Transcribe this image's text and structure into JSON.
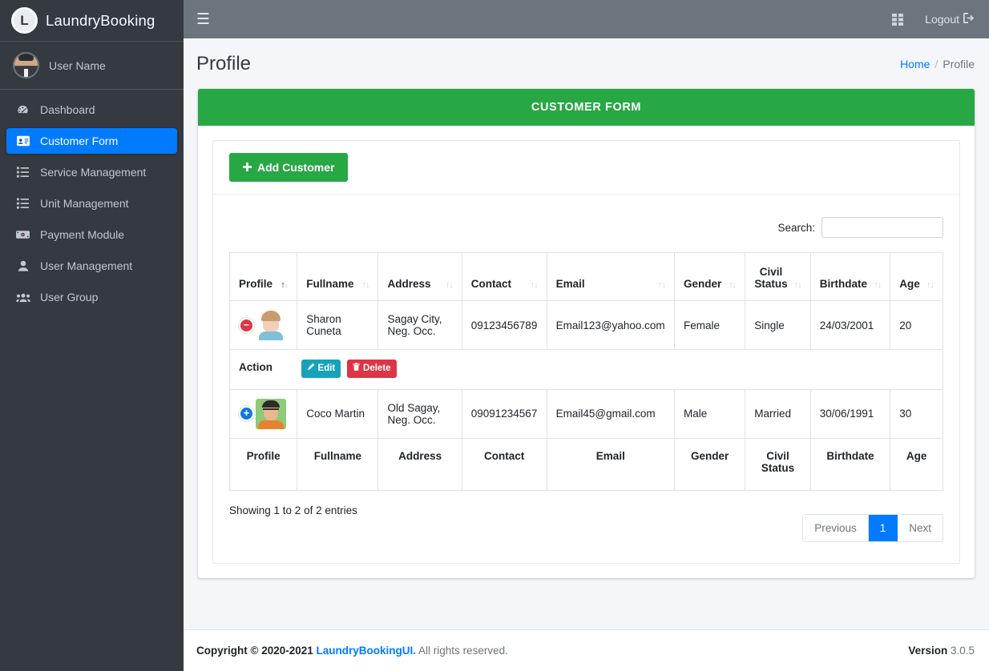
{
  "sidebar": {
    "brand": {
      "logo_letter": "L",
      "title": "LaundryBooking"
    },
    "user": {
      "name": "User Name",
      "avatar_icon": "user-avatar"
    },
    "items": [
      {
        "label": "Dashboard",
        "icon": "tachometer-icon",
        "active": false
      },
      {
        "label": "Customer Form",
        "icon": "id-card-icon",
        "active": true
      },
      {
        "label": "Service Management",
        "icon": "list-icon",
        "active": false
      },
      {
        "label": "Unit Management",
        "icon": "list-icon",
        "active": false
      },
      {
        "label": "Payment Module",
        "icon": "money-bill-icon",
        "active": false
      },
      {
        "label": "User Management",
        "icon": "user-icon",
        "active": false
      },
      {
        "label": "User Group",
        "icon": "users-icon",
        "active": false
      }
    ]
  },
  "topbar": {
    "menu_toggle_icon": "hamburger-icon",
    "grid_icon": "th-grid-icon",
    "logout_label": "Logout",
    "logout_icon": "sign-out-icon"
  },
  "content_header": {
    "title": "Profile",
    "breadcrumb": {
      "home": "Home",
      "separator": "/",
      "current": "Profile"
    }
  },
  "card": {
    "header_title": "CUSTOMER FORM",
    "header_color": "#28a745",
    "add_button": {
      "label": "Add Customer",
      "icon": "plus-icon"
    }
  },
  "search": {
    "label": "Search:",
    "value": "",
    "placeholder": ""
  },
  "table": {
    "columns": [
      {
        "label": "Profile",
        "sort": "asc"
      },
      {
        "label": "Fullname",
        "sort": "none"
      },
      {
        "label": "Address",
        "sort": "none"
      },
      {
        "label": "Contact",
        "sort": "none"
      },
      {
        "label": "Email",
        "sort": "none"
      },
      {
        "label": "Gender",
        "sort": "none"
      },
      {
        "label": "Civil Status",
        "sort": "none"
      },
      {
        "label": "Birthdate",
        "sort": "none"
      },
      {
        "label": "Age",
        "sort": "none"
      }
    ],
    "footer_columns": [
      "Profile",
      "Fullname",
      "Address",
      "Contact",
      "Email",
      "Gender",
      "Civil Status",
      "Birthdate",
      "Age"
    ],
    "rows": [
      {
        "toggle": "minus",
        "toggle_icon": "collapse-row-icon",
        "avatar": "female-avatar",
        "fullname": "Sharon Cuneta",
        "address": "Sagay City, Neg. Occ.",
        "contact": "09123456789",
        "email": "Email123@yahoo.com",
        "gender": "Female",
        "civil_status": "Single",
        "birthdate": "24/03/2001",
        "age": "20",
        "expanded": true
      },
      {
        "toggle": "plus",
        "toggle_icon": "expand-row-icon",
        "avatar": "male-avatar",
        "fullname": "Coco Martin",
        "address": "Old Sagay, Neg. Occ.",
        "contact": "09091234567",
        "email": "Email45@gmail.com",
        "gender": "Male",
        "civil_status": "Married",
        "birthdate": "30/06/1991",
        "age": "30",
        "expanded": false
      }
    ],
    "action_row": {
      "label": "Action",
      "edit_label": "Edit",
      "edit_icon": "pencil-icon",
      "delete_label": "Delete",
      "delete_icon": "trash-icon"
    }
  },
  "pagination": {
    "info": "Showing 1 to 2 of 2 entries",
    "previous": "Previous",
    "pages": [
      "1"
    ],
    "next": "Next",
    "current_page": "1"
  },
  "footer": {
    "copyright_prefix": "Copyright © 2020-2021",
    "brand": "LaundryBookingUI.",
    "copyright_suffix": "All rights reserved.",
    "version_label": "Version",
    "version_number": "3.0.5"
  }
}
